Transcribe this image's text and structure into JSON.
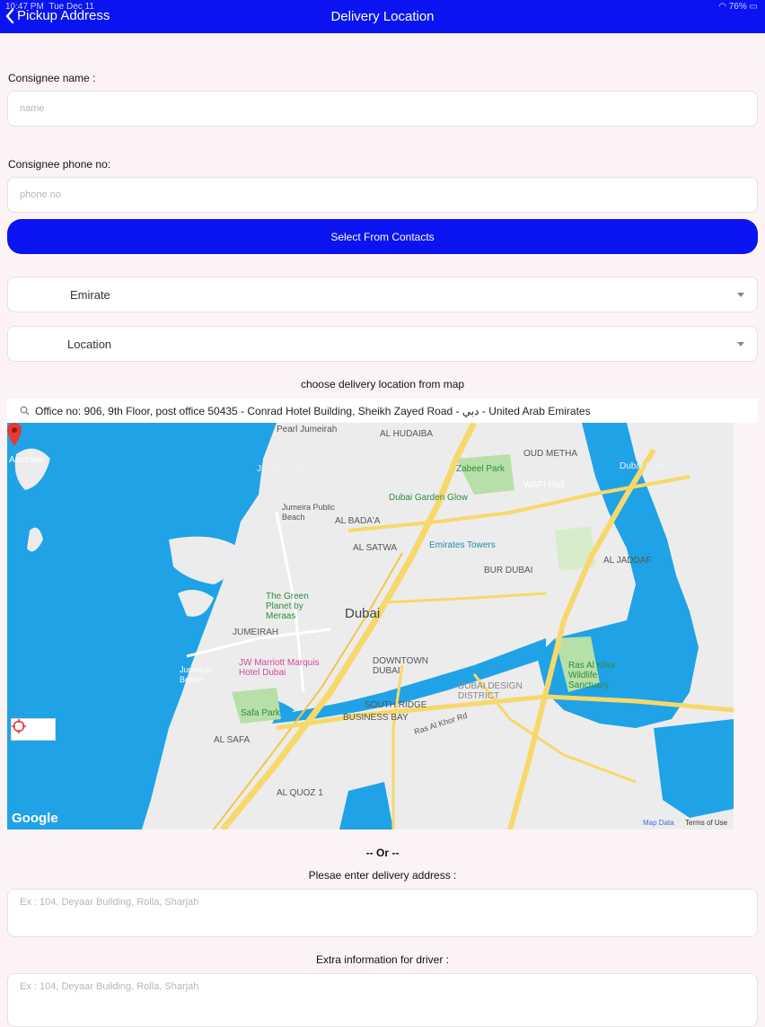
{
  "status": {
    "time": "10:47 PM",
    "date": "Tue Dec 11",
    "battery": "76%"
  },
  "nav": {
    "back_label": "Pickup Address",
    "title": "Delivery Location"
  },
  "form": {
    "consignee_name_label": "Consignee name :",
    "name_placeholder": "name",
    "consignee_phone_label": "Consignee phone no:",
    "phone_placeholder": "phone no",
    "select_contacts_label": "Select From Contacts",
    "emirate_value": "Emirate",
    "location_value": "Location",
    "map_prompt": "choose delivery location from map",
    "search_text": "Office no: 906, 9th Floor, post office 50435 - Conrad Hotel Building, Sheikh Zayed Road - دبي - United Arab Emirates",
    "or_label": "-- Or --",
    "address_label": "Plesae enter delivery address :",
    "address_placeholder": "Ex : 104, Deyaar Building, Rolla, Sharjah",
    "extra_label": "Extra information for driver :",
    "extra_placeholder": "Ex : 104, Deyaar Building, Rolla, Sharjah"
  },
  "map": {
    "labels": {
      "pearl": "Pearl Jumeirah",
      "hudaiba": "AL HUDAIBA",
      "oud_metha": "OUD METHA",
      "australia": "Australia",
      "jumeirah_mosque": "Jumeirah Mosque",
      "zabeel": "Zabeel Park",
      "dolphinarium": "Dubai Dolphinarium",
      "wafi": "WAFI Mall",
      "garden_glow": "Dubai Garden Glow",
      "public_beach": "Jumeira Public Beach",
      "bada": "AL BADA'A",
      "satwa": "AL SATWA",
      "emirates_towers": "Emirates Towers",
      "mercato": "Mercato Shopping Mall",
      "jaddaf": "AL JADDAF",
      "bur_dubai": "BUR DUBAI",
      "green_planet": "The Green Planet by Meraas",
      "dubai": "Dubai",
      "jumeirah": "JUMEIRAH",
      "jw": "JW Marriott Marquis Hotel Dubai",
      "downtown": "DOWNTOWN DUBAI",
      "design": "DUBAI DESIGN DISTRICT",
      "ras_al_khor": "Ras Al Khor Wildlife Sanctuary",
      "jumeirah_beach": "Jumeirah Beach",
      "south_ridge": "SOUTH RIDGE",
      "business_bay": "BUSINESS BAY",
      "safa_park": "Safa Park",
      "al_safa": "AL SAFA",
      "quoz": "AL QUOZ 1",
      "ras_al_khor_rd": "Ras Al Khor Rd"
    },
    "google": "Google",
    "map_data": "Map Data",
    "terms": "Terms of Use"
  },
  "colors": {
    "accent": "#0a14f0",
    "water": "#1fa3e6",
    "park": "#b6e0a8",
    "road": "#f7d86a",
    "land": "#ececec"
  }
}
